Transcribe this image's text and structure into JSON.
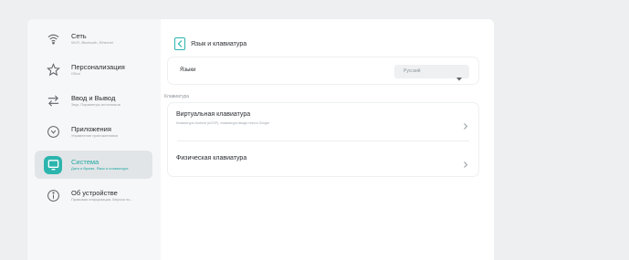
{
  "sidebar": {
    "items": [
      {
        "icon": "wifi-icon",
        "title": "Сеть",
        "subtitle": "Wi-Fi, Bluetooth, Ethernet",
        "active": false
      },
      {
        "icon": "star-icon",
        "title": "Персонализация",
        "subtitle": "Обои",
        "active": false
      },
      {
        "icon": "input-output-icon",
        "title": "Ввод и Вывод",
        "subtitle": "Звук, Параметры источников",
        "active": false
      },
      {
        "icon": "apps-icon",
        "title": "Приложения",
        "subtitle": "Управление приложениями",
        "active": false
      },
      {
        "icon": "system-icon",
        "title": "Система",
        "subtitle": "Дата и Время, Язык и клавиатура",
        "active": true
      },
      {
        "icon": "info-icon",
        "title": "Об устройстве",
        "subtitle": "Правовая информация, Версия по...",
        "active": false
      }
    ]
  },
  "header": {
    "title": "Язык и клавиатура"
  },
  "language": {
    "label": "Языки",
    "selected": "Русский"
  },
  "keyboard": {
    "section_label": "Клавиатура",
    "items": [
      {
        "title": "Виртуальная клавиатура",
        "subtitle": "Клавиатура Android (AOSP), клавиатура ввода текста Google"
      },
      {
        "title": "Физическая клавиатура",
        "subtitle": ""
      }
    ]
  },
  "colors": {
    "accent": "#2bb5ad",
    "background": "#eeeff1",
    "panel": "#ffffff",
    "sidebar": "#f6f7f8"
  }
}
